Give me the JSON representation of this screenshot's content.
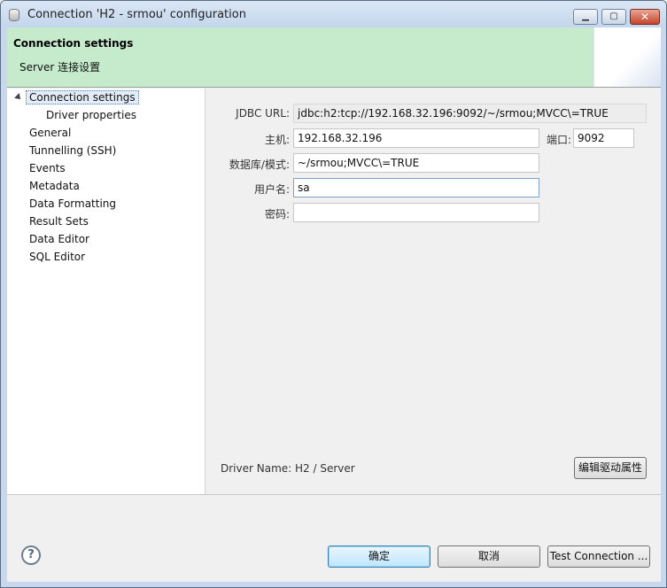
{
  "window": {
    "title": "Connection 'H2 - srmou' configuration",
    "controls": {
      "minimize": "▁",
      "maximize": "▢",
      "close": "✕"
    }
  },
  "header": {
    "title": "Connection settings",
    "subtitle": "Server 连接设置"
  },
  "tree": {
    "items": [
      {
        "label": "Connection settings",
        "selected": true
      },
      {
        "label": "Driver properties"
      },
      {
        "label": "General"
      },
      {
        "label": "Tunnelling (SSH)"
      },
      {
        "label": "Events"
      },
      {
        "label": "Metadata"
      },
      {
        "label": "Data Formatting"
      },
      {
        "label": "Result Sets"
      },
      {
        "label": "Data Editor"
      },
      {
        "label": "SQL Editor"
      }
    ]
  },
  "form": {
    "jdbc_url": {
      "label": "JDBC URL:",
      "value": "jdbc:h2:tcp://192.168.32.196:9092/~/srmou;MVCC\\=TRUE"
    },
    "host": {
      "label": "主机:",
      "value": "192.168.32.196"
    },
    "port": {
      "label": "端口:",
      "value": "9092"
    },
    "database": {
      "label": "数据库/模式:",
      "value": "~/srmou;MVCC\\=TRUE"
    },
    "username": {
      "label": "用户名:",
      "value": "sa"
    },
    "password": {
      "label": "密码:",
      "value": ""
    }
  },
  "driver": {
    "label": "Driver Name:",
    "value": "H2 / Server",
    "edit_button": "编辑驱动属性"
  },
  "footer": {
    "help_icon": "?",
    "ok": "确定",
    "cancel": "取消",
    "test": "Test Connection ..."
  },
  "colors": {
    "header_bg": "#c5eacc",
    "default_button": "#bde6fd"
  }
}
